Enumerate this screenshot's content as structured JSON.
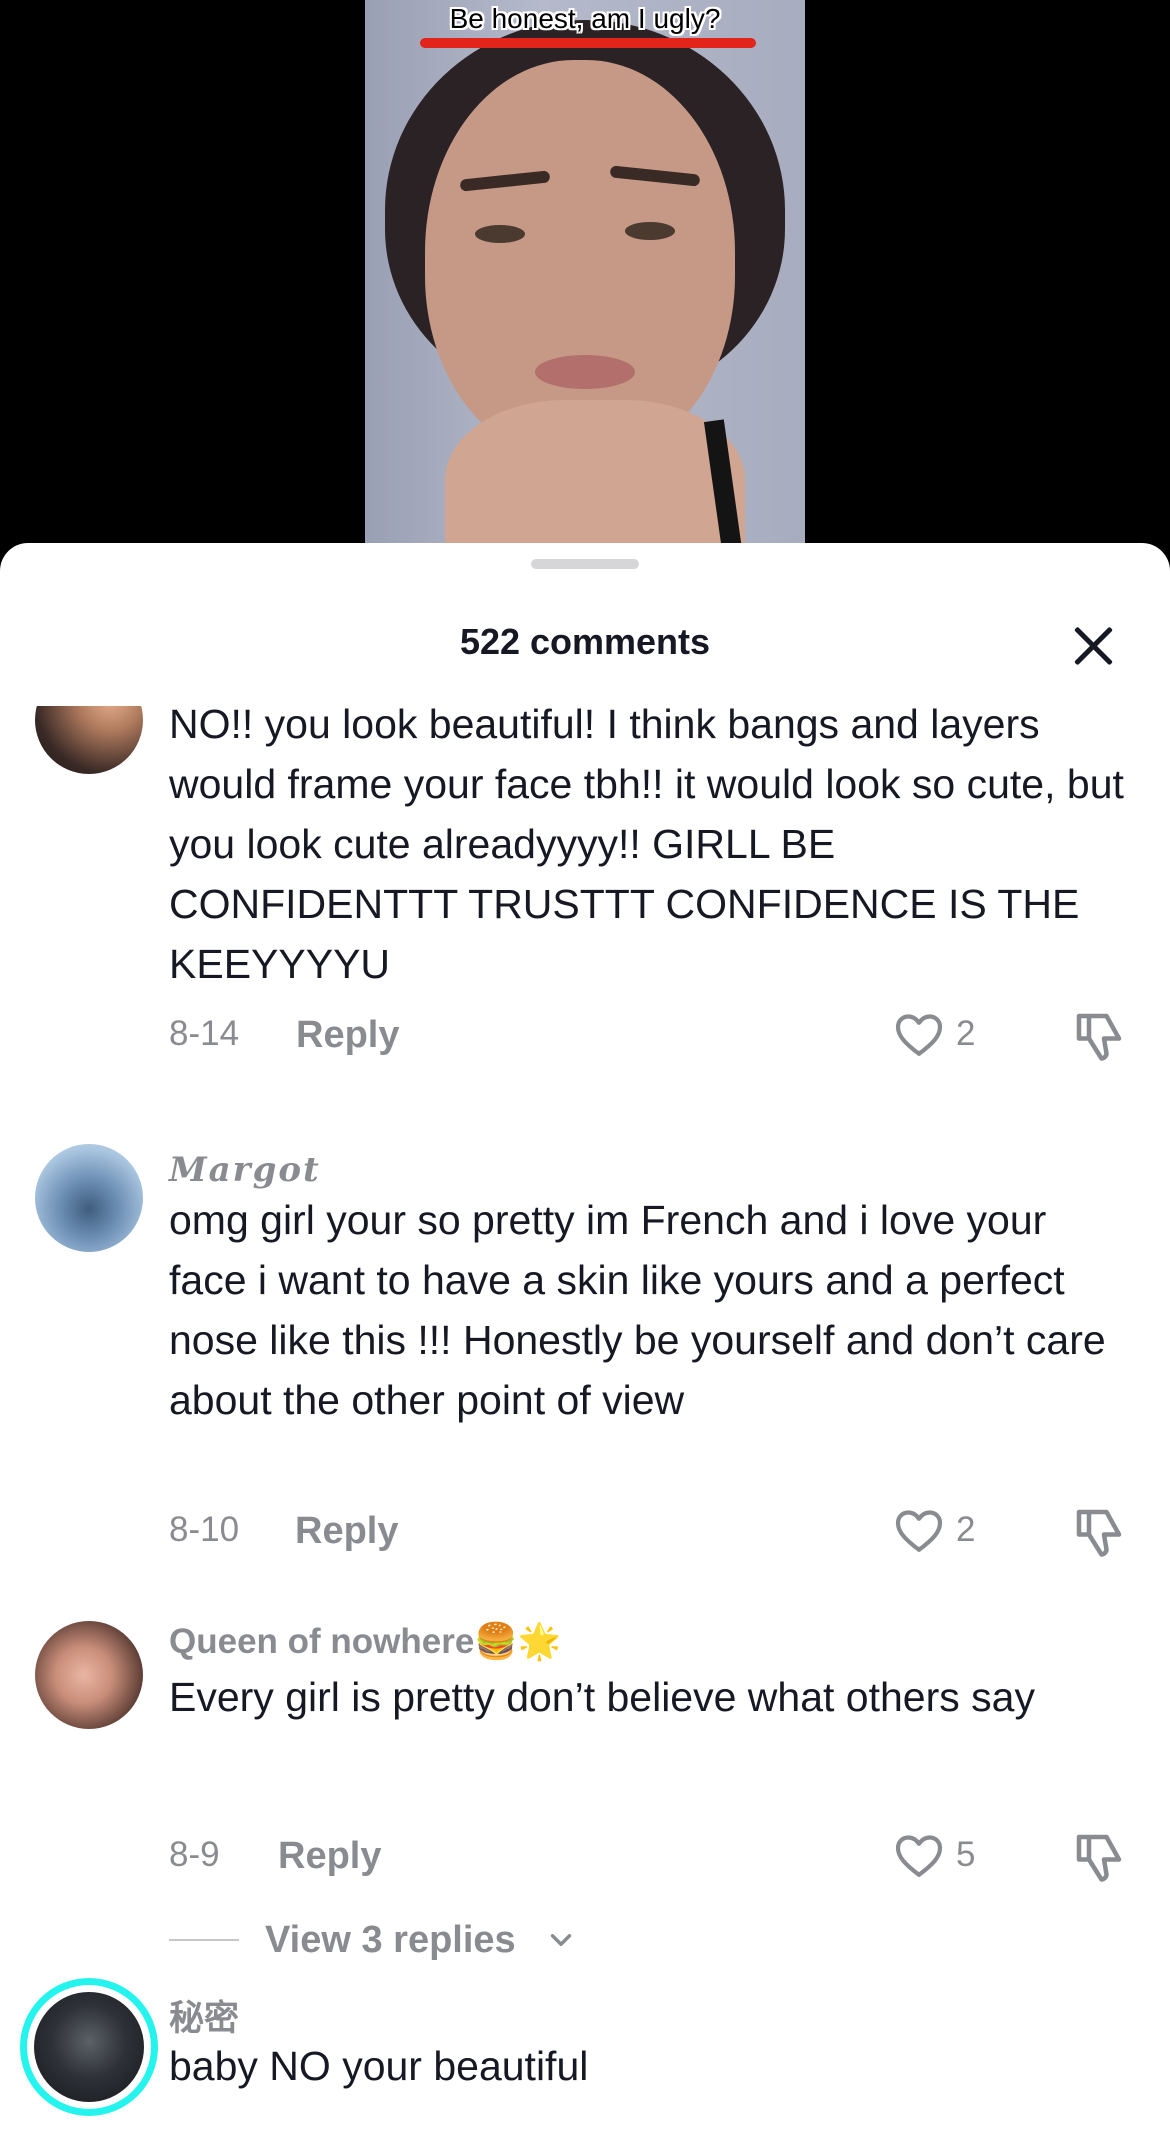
{
  "video": {
    "caption": "Be honest, am I ugly?"
  },
  "sheet": {
    "title": "522 comments"
  },
  "comments": [
    {
      "username": "",
      "text": "NO!! you look beautiful! I think bangs and layers would frame your face tbh!! it would look so cute, but you look cute alreadyyyy!! GIRLL BE CONFIDENTTT TRUSTTT CONFIDENCE IS THE KEEYYYYU",
      "date": "8-14",
      "reply_label": "Reply",
      "likes": "2"
    },
    {
      "username": "Margot",
      "text": "omg girl your so pretty im French and i love your face i want to have a skin like yours and a perfect nose like this !!! Honestly be yourself and don’t care about the other point of view",
      "date": "8-10",
      "reply_label": "Reply",
      "likes": "2"
    },
    {
      "username": "Queen of nowhere🍔🌟",
      "text": "Every girl is pretty don’t believe what others say",
      "date": "8-9",
      "reply_label": "Reply",
      "likes": "5",
      "view_replies_label": "View 3 replies"
    },
    {
      "username": "秘密",
      "text": "baby NO your beautiful"
    }
  ],
  "colors": {
    "accent_ring": "#25f4ee",
    "caption_underline": "#e3241b",
    "muted_text": "#8a8b91",
    "primary_text": "#161823"
  },
  "icons": [
    "close-icon",
    "heart-icon",
    "dislike-icon",
    "chevron-down-icon"
  ]
}
